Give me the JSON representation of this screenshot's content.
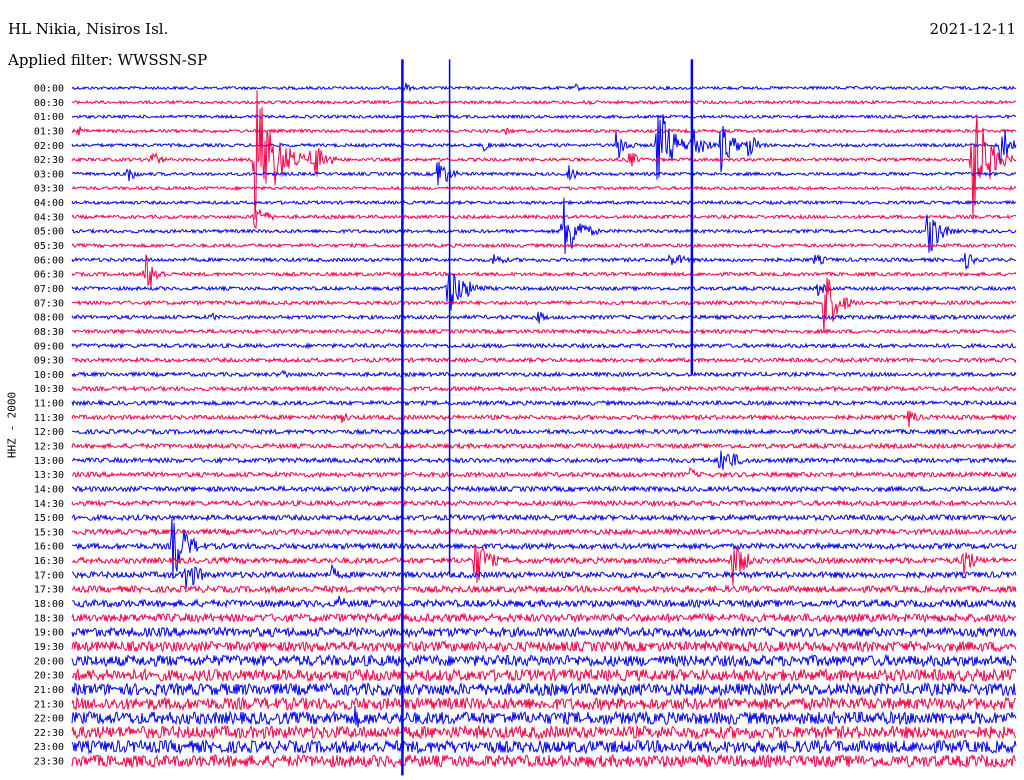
{
  "header": {
    "station": "HL Nikia, Nisiros Isl.",
    "date": "2021-12-11",
    "filter": "Applied filter: WWSSN-SP"
  },
  "chart_data": {
    "type": "line",
    "title": "HL Nikia, Nisiros Isl.",
    "ylabel": "HHZ - 2000",
    "rows": [
      "00:00",
      "00:30",
      "01:00",
      "01:30",
      "02:00",
      "02:30",
      "03:00",
      "03:30",
      "04:00",
      "04:30",
      "05:00",
      "05:30",
      "06:00",
      "06:30",
      "07:00",
      "07:30",
      "08:00",
      "08:30",
      "09:00",
      "09:30",
      "10:00",
      "10:30",
      "11:00",
      "11:30",
      "12:00",
      "12:30",
      "13:00",
      "13:30",
      "14:00",
      "14:30",
      "15:00",
      "15:30",
      "16:00",
      "16:30",
      "17:00",
      "17:30",
      "18:00",
      "18:30",
      "19:00",
      "19:30",
      "20:00",
      "20:30",
      "21:00",
      "21:30",
      "22:00",
      "22:30",
      "23:00",
      "23:30"
    ],
    "x_range_minutes": [
      0,
      30
    ],
    "series_colors": [
      "#0000ff",
      "#ff0044"
    ],
    "noise_levels": [
      1.5,
      1.5,
      1.5,
      1.6,
      1.6,
      1.6,
      1.6,
      1.6,
      1.6,
      1.7,
      1.7,
      1.7,
      1.8,
      1.8,
      1.8,
      1.9,
      1.9,
      1.9,
      2.0,
      2.0,
      2.0,
      2.1,
      2.1,
      2.2,
      2.2,
      2.3,
      2.3,
      2.4,
      2.5,
      2.5,
      2.6,
      2.7,
      2.8,
      2.9,
      3.0,
      3.2,
      3.5,
      4.0,
      4.5,
      5.0,
      5.5,
      5.8,
      6.0,
      6.0,
      6.2,
      6.2,
      6.2,
      6.0
    ],
    "events": [
      {
        "row": 0,
        "minute": 10.6,
        "amplitude": 6,
        "duration_min": 0.5
      },
      {
        "row": 0,
        "minute": 16.0,
        "amplitude": 5,
        "duration_min": 0.5
      },
      {
        "row": 1,
        "minute": 16.3,
        "amplitude": 6,
        "duration_min": 0.6
      },
      {
        "row": 3,
        "minute": 0.2,
        "amplitude": 6,
        "duration_min": 0.5
      },
      {
        "row": 3,
        "minute": 13.8,
        "amplitude": 5,
        "duration_min": 0.6
      },
      {
        "row": 4,
        "minute": 13.1,
        "amplitude": 8,
        "duration_min": 0.5
      },
      {
        "row": 4,
        "minute": 17.3,
        "amplitude": 20,
        "duration_min": 0.8
      },
      {
        "row": 4,
        "minute": 18.6,
        "amplitude": 50,
        "duration_min": 1.2
      },
      {
        "row": 4,
        "minute": 19.7,
        "amplitude": 24,
        "duration_min": 0.9
      },
      {
        "row": 4,
        "minute": 20.6,
        "amplitude": 30,
        "duration_min": 1.0
      },
      {
        "row": 4,
        "minute": 21.5,
        "amplitude": 16,
        "duration_min": 0.8
      },
      {
        "row": 4,
        "minute": 29.5,
        "amplitude": 26,
        "duration_min": 0.9
      },
      {
        "row": 5,
        "minute": 2.5,
        "amplitude": 12,
        "duration_min": 0.8
      },
      {
        "row": 5,
        "minute": 5.8,
        "amplitude": 90,
        "duration_min": 1.6
      },
      {
        "row": 5,
        "minute": 7.6,
        "amplitude": 30,
        "duration_min": 1.0
      },
      {
        "row": 5,
        "minute": 28.6,
        "amplitude": 70,
        "duration_min": 1.3
      },
      {
        "row": 5,
        "minute": 17.7,
        "amplitude": 12,
        "duration_min": 0.7
      },
      {
        "row": 6,
        "minute": 1.7,
        "amplitude": 12,
        "duration_min": 0.8
      },
      {
        "row": 6,
        "minute": 11.6,
        "amplitude": 22,
        "duration_min": 0.9
      },
      {
        "row": 6,
        "minute": 15.8,
        "amplitude": 10,
        "duration_min": 0.7
      },
      {
        "row": 9,
        "minute": 5.8,
        "amplitude": 18,
        "duration_min": 0.9
      },
      {
        "row": 10,
        "minute": 15.6,
        "amplitude": 40,
        "duration_min": 1.2
      },
      {
        "row": 10,
        "minute": 27.2,
        "amplitude": 30,
        "duration_min": 1.0
      },
      {
        "row": 12,
        "minute": 13.4,
        "amplitude": 8,
        "duration_min": 1.0
      },
      {
        "row": 12,
        "minute": 19.0,
        "amplitude": 8,
        "duration_min": 1.6
      },
      {
        "row": 12,
        "minute": 23.6,
        "amplitude": 6,
        "duration_min": 1.5
      },
      {
        "row": 12,
        "minute": 28.4,
        "amplitude": 10,
        "duration_min": 0.9
      },
      {
        "row": 13,
        "minute": 2.3,
        "amplitude": 26,
        "duration_min": 0.9
      },
      {
        "row": 14,
        "minute": 11.9,
        "amplitude": 30,
        "duration_min": 1.5
      },
      {
        "row": 14,
        "minute": 23.7,
        "amplitude": 8,
        "duration_min": 0.8
      },
      {
        "row": 15,
        "minute": 23.9,
        "amplitude": 40,
        "duration_min": 1.1
      },
      {
        "row": 16,
        "minute": 4.4,
        "amplitude": 6,
        "duration_min": 0.6
      },
      {
        "row": 16,
        "minute": 14.8,
        "amplitude": 8,
        "duration_min": 0.7
      },
      {
        "row": 20,
        "minute": 6.7,
        "amplitude": 6,
        "duration_min": 0.7
      },
      {
        "row": 23,
        "minute": 8.6,
        "amplitude": 8,
        "duration_min": 0.6
      },
      {
        "row": 23,
        "minute": 26.6,
        "amplitude": 12,
        "duration_min": 0.7
      },
      {
        "row": 26,
        "minute": 20.6,
        "amplitude": 16,
        "duration_min": 1.5
      },
      {
        "row": 27,
        "minute": 19.6,
        "amplitude": 10,
        "duration_min": 0.6
      },
      {
        "row": 32,
        "minute": 3.2,
        "amplitude": 40,
        "duration_min": 1.2
      },
      {
        "row": 33,
        "minute": 12.8,
        "amplitude": 30,
        "duration_min": 1.1
      },
      {
        "row": 33,
        "minute": 21.0,
        "amplitude": 28,
        "duration_min": 1.0
      },
      {
        "row": 33,
        "minute": 28.3,
        "amplitude": 20,
        "duration_min": 0.9
      },
      {
        "row": 34,
        "minute": 8.2,
        "amplitude": 12,
        "duration_min": 0.8
      },
      {
        "row": 34,
        "minute": 3.6,
        "amplitude": 20,
        "duration_min": 1.2
      },
      {
        "row": 36,
        "minute": 8.5,
        "amplitude": 10,
        "duration_min": 0.7
      },
      {
        "row": 44,
        "minute": 9.0,
        "amplitude": 14,
        "duration_min": 0.7
      }
    ],
    "verticals": [
      {
        "minute": 10.5,
        "row_start": -2,
        "row_end": 48,
        "color": "#0000ff",
        "width": 2.5
      },
      {
        "minute": 12.0,
        "row_start": -2,
        "row_end": 34,
        "color": "#0000ff",
        "width": 1.5
      },
      {
        "minute": 19.7,
        "row_start": -2,
        "row_end": 20,
        "color": "#0000ff",
        "width": 2.5
      }
    ]
  }
}
